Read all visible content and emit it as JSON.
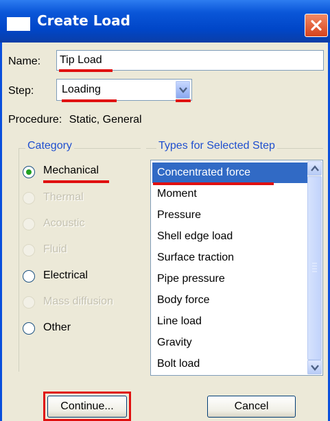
{
  "window": {
    "title": "Create Load",
    "accent_color": "#0a4fdc",
    "highlight_color": "#e01010"
  },
  "name_field": {
    "label": "Name:",
    "value": "Tip Load"
  },
  "step_field": {
    "label": "Step:",
    "value": "Loading"
  },
  "procedure": {
    "label": "Procedure:",
    "value": "Static, General"
  },
  "category": {
    "title": "Category",
    "options": [
      {
        "label": "Mechanical",
        "selected": true,
        "enabled": true
      },
      {
        "label": "Thermal",
        "selected": false,
        "enabled": false
      },
      {
        "label": "Acoustic",
        "selected": false,
        "enabled": false
      },
      {
        "label": "Fluid",
        "selected": false,
        "enabled": false
      },
      {
        "label": "Electrical",
        "selected": false,
        "enabled": true
      },
      {
        "label": "Mass diffusion",
        "selected": false,
        "enabled": false
      },
      {
        "label": "Other",
        "selected": false,
        "enabled": true
      }
    ]
  },
  "types": {
    "title": "Types for Selected Step",
    "items": [
      "Concentrated force",
      "Moment",
      "Pressure",
      "Shell edge load",
      "Surface traction",
      "Pipe pressure",
      "Body force",
      "Line load",
      "Gravity",
      "Bolt load"
    ],
    "selected": "Concentrated force"
  },
  "buttons": {
    "continue_label": "Continue...",
    "cancel_label": "Cancel"
  }
}
